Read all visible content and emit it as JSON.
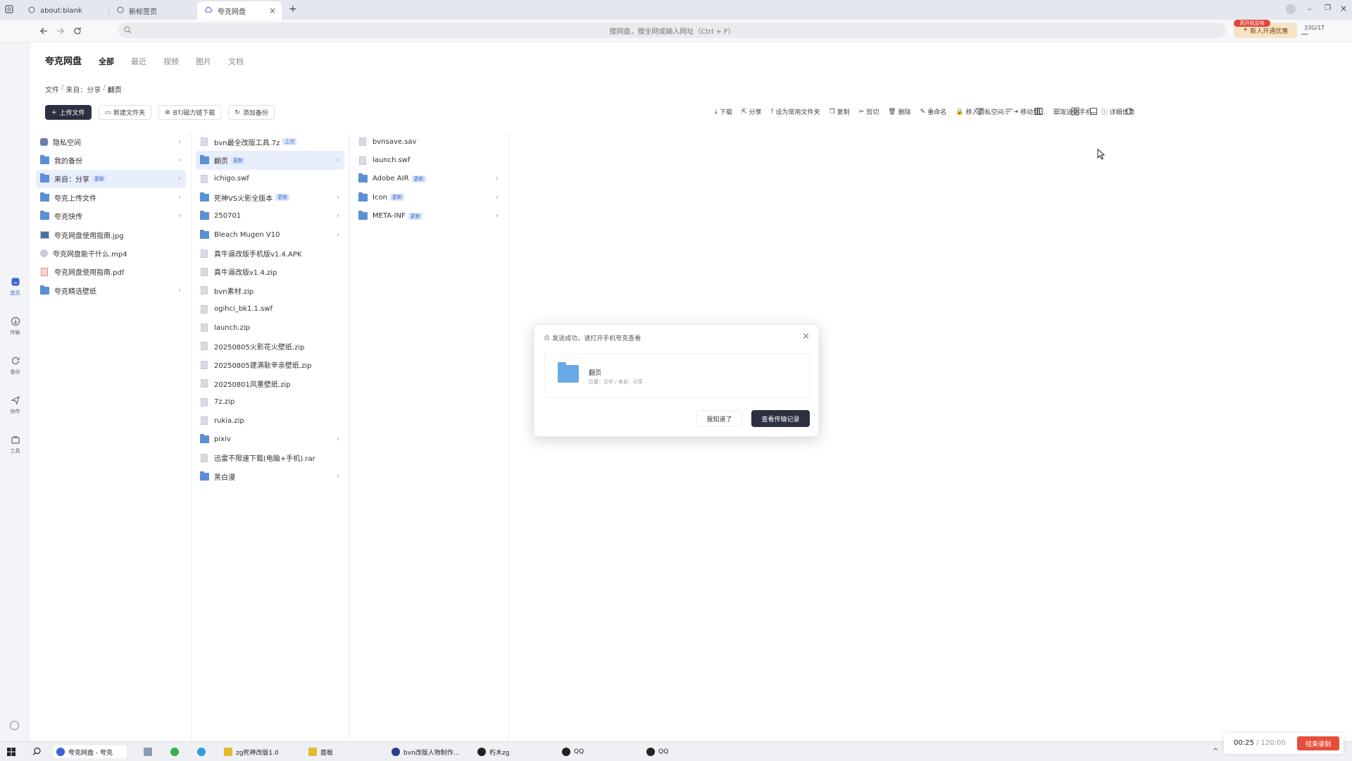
{
  "browser": {
    "tabs": [
      {
        "label": "about:blank",
        "icon": "page-icon"
      },
      {
        "label": "新标签页",
        "icon": "page-icon"
      },
      {
        "label": "夸克网盘",
        "icon": "cloud-icon",
        "active": true
      }
    ],
    "new_tab": "+",
    "address_placeholder": "搜网盘，搜全网或输入网址（Ctrl + F）",
    "promo_badge": "高开机显特",
    "promo_label": "新人开通优惠",
    "storage": "33G/1T"
  },
  "rail": {
    "items": [
      {
        "label": "首页",
        "icon": "home-icon",
        "active": true
      },
      {
        "label": "传输",
        "icon": "transfer-icon"
      },
      {
        "label": "备份",
        "icon": "backup-icon"
      },
      {
        "label": "快传",
        "icon": "send-icon"
      },
      {
        "label": "工具",
        "icon": "tool-icon"
      }
    ]
  },
  "header": {
    "app_title": "夸克网盘",
    "filters": [
      "全部",
      "最近",
      "视频",
      "图片",
      "文档"
    ]
  },
  "breadcrumb": [
    "文件",
    "来自：分享",
    "翻页"
  ],
  "actions": {
    "upload": "上传文件",
    "new_folder": "新建文件夹",
    "bt": "BT/磁力链下载",
    "backup": "添加备份"
  },
  "toolbar": [
    "下载",
    "分享",
    "设为常用文件夹",
    "复制",
    "剪切",
    "删除",
    "重命名",
    "移入隐私空间",
    "移动到...",
    "发送到手机",
    "详细信息"
  ],
  "columns": {
    "col1": [
      {
        "name": "隐私空间",
        "type": "lock",
        "chev": true
      },
      {
        "name": "我的备份",
        "type": "folder",
        "chev": true
      },
      {
        "name": "来自：分享",
        "type": "folder",
        "chev": true,
        "badge": "更新",
        "selected": true
      },
      {
        "name": "夸克上传文件",
        "type": "folder",
        "chev": true
      },
      {
        "name": "夸克快传",
        "type": "folder",
        "chev": true
      },
      {
        "name": "夸克网盘使用指南.jpg",
        "type": "img"
      },
      {
        "name": "夸克网盘能干什么.mp4",
        "type": "vid"
      },
      {
        "name": "夸克网盘使用指南.pdf",
        "type": "pdf"
      },
      {
        "name": "夸克精选壁纸",
        "type": "folder",
        "chev": true
      }
    ],
    "col2": [
      {
        "name": "bvn最全改版工具.7z",
        "type": "file",
        "badge": "上次"
      },
      {
        "name": "翻页",
        "type": "folder",
        "chev": true,
        "badge": "更新",
        "selected": true
      },
      {
        "name": "ichigo.swf",
        "type": "file"
      },
      {
        "name": "死神VS火影全版本",
        "type": "folder",
        "chev": true,
        "badge": "更新"
      },
      {
        "name": "250701",
        "type": "folder",
        "chev": true
      },
      {
        "name": "Bleach Mugen V10",
        "type": "folder",
        "chev": true
      },
      {
        "name": "真牛逼改版手机版v1.4.APK",
        "type": "file"
      },
      {
        "name": "真牛逼改版v1.4.zip",
        "type": "file"
      },
      {
        "name": "bvn素材.zip",
        "type": "file"
      },
      {
        "name": "ogihci_bk1.1.swf",
        "type": "file"
      },
      {
        "name": "launch.zip",
        "type": "file"
      },
      {
        "name": "20250805火影花火壁纸.zip",
        "type": "file"
      },
      {
        "name": "20250805建满耿辛亲壁纸.zip",
        "type": "file"
      },
      {
        "name": "20250801风董壁纸.zip",
        "type": "file"
      },
      {
        "name": "7z.zip",
        "type": "file"
      },
      {
        "name": "rukia.zip",
        "type": "file"
      },
      {
        "name": "pixiv",
        "type": "folder",
        "chev": true
      },
      {
        "name": "迅雷不限速下载(电脑+手机).rar",
        "type": "file"
      },
      {
        "name": "黑白漫",
        "type": "folder",
        "chev": true
      }
    ],
    "col3": [
      {
        "name": "bvnsave.sav",
        "type": "file"
      },
      {
        "name": "launch.swf",
        "type": "file"
      },
      {
        "name": "Adobe AIR",
        "type": "folder",
        "chev": true,
        "badge": "更新"
      },
      {
        "name": "Icon",
        "type": "folder",
        "chev": true,
        "badge": "更新"
      },
      {
        "name": "META-INF",
        "type": "folder",
        "chev": true,
        "badge": "更新"
      }
    ]
  },
  "dialog": {
    "title": "发送成功，请打开手机夸克查看",
    "folder_name": "翻页",
    "folder_path": "位置：文件 / 来自：分享",
    "ok_label": "我知道了",
    "view_label": "查看传输记录"
  },
  "taskbar": {
    "items": [
      {
        "label": "夸克网盘 - 夸克",
        "color": "#3b63d8",
        "active": true
      },
      {
        "label": "",
        "color": "#8c9bb0"
      },
      {
        "label": "",
        "color": "#3bb04a"
      },
      {
        "label": "",
        "color": "#2f9fd9"
      },
      {
        "label": "zg死神改版1.0",
        "color": "#e8b82c"
      },
      {
        "label": "面板",
        "color": "#e8b82c"
      },
      {
        "label": "bvn改版人物制作...",
        "color": "#2b3f8f"
      },
      {
        "label": "朽木zg",
        "color": "#222222"
      },
      {
        "label": "QQ",
        "color": "#222222"
      },
      {
        "label": "QQ",
        "color": "#222222"
      }
    ],
    "rec_time": "00:25",
    "rec_total": " / 120:00",
    "rec_stop": "结束录制"
  }
}
